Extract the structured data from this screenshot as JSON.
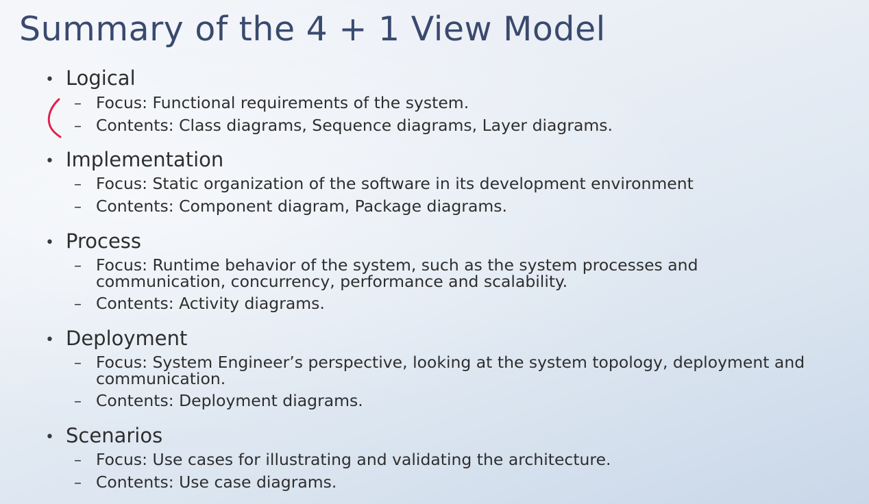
{
  "slide": {
    "title": "Summary of the 4 + 1 View Model",
    "bullet_char": "•",
    "dash_char": "–",
    "sections": [
      {
        "title": "Logical",
        "items": [
          "Focus: Functional requirements of the system.",
          "Contents: Class diagrams, Sequence diagrams, Layer diagrams."
        ]
      },
      {
        "title": "Implementation",
        "items": [
          "Focus: Static organization of the software in its development environment",
          "Contents: Component diagram, Package diagrams."
        ]
      },
      {
        "title": "Process",
        "items": [
          "Focus: Runtime behavior of the system, such as the system processes and communication, concurrency, performance and scalability.",
          "Contents: Activity diagrams."
        ]
      },
      {
        "title": "Deployment",
        "items": [
          "Focus: System Engineer’s perspective, looking at the system topology, deployment and communication.",
          "Contents: Deployment diagrams."
        ]
      },
      {
        "title": "Scenarios",
        "items": [
          "Focus: Use cases for illustrating and validating the architecture.",
          "Contents: Use case diagrams."
        ]
      }
    ]
  },
  "colors": {
    "title": "#3a4a6e",
    "text": "#2e2e2e",
    "annotation": "#e0204a"
  }
}
